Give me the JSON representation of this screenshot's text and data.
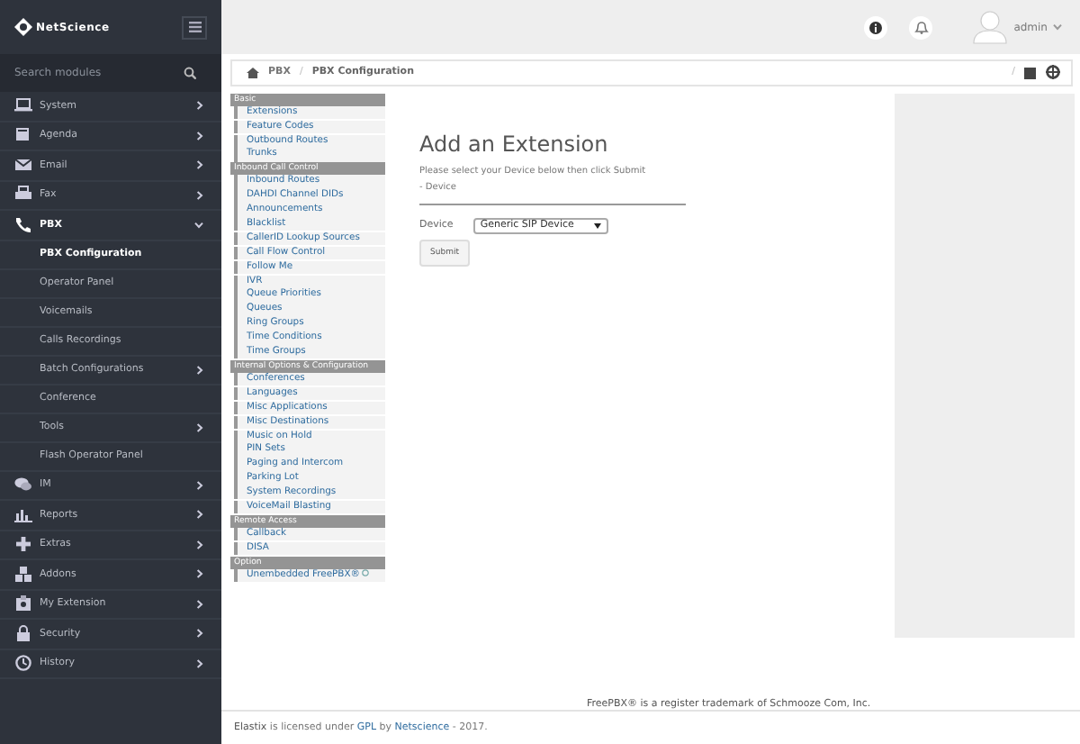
{
  "sidebar": {
    "brand": "NetScience",
    "search": {
      "placeholder": "Search modules"
    },
    "items": [
      {
        "label": "System",
        "expandable": true,
        "expanded": false
      },
      {
        "label": "Agenda",
        "expandable": true,
        "expanded": false
      },
      {
        "label": "Email",
        "expandable": true,
        "expanded": false
      },
      {
        "label": "Fax",
        "expandable": true,
        "expanded": false
      },
      {
        "label": "PBX",
        "expandable": true,
        "expanded": true,
        "children": [
          {
            "label": "PBX Configuration",
            "selected": true,
            "expandable": false
          },
          {
            "label": "Operator Panel",
            "selected": false,
            "expandable": false
          },
          {
            "label": "Voicemails",
            "selected": false,
            "expandable": false
          },
          {
            "label": "Calls Recordings",
            "selected": false,
            "expandable": false
          },
          {
            "label": "Batch Configurations",
            "selected": false,
            "expandable": true
          },
          {
            "label": "Conference",
            "selected": false,
            "expandable": false
          },
          {
            "label": "Tools",
            "selected": false,
            "expandable": true
          },
          {
            "label": "Flash Operator Panel",
            "selected": false,
            "expandable": false
          }
        ]
      },
      {
        "label": "IM",
        "expandable": true,
        "expanded": false
      },
      {
        "label": "Reports",
        "expandable": true,
        "expanded": false
      },
      {
        "label": "Extras",
        "expandable": true,
        "expanded": false
      },
      {
        "label": "Addons",
        "expandable": true,
        "expanded": false
      },
      {
        "label": "My Extension",
        "expandable": true,
        "expanded": false
      },
      {
        "label": "Security",
        "expandable": true,
        "expanded": false
      },
      {
        "label": "History",
        "expandable": true,
        "expanded": false
      }
    ]
  },
  "topbar": {
    "user": "admin"
  },
  "breadcrumb": {
    "items": [
      "PBX",
      "PBX Configuration"
    ],
    "separator": "/",
    "right_text": "/"
  },
  "pbx_nav": [
    {
      "heading": "Basic",
      "items": [
        "Extensions",
        "Feature Codes",
        "Outbound Routes",
        "Trunks"
      ]
    },
    {
      "heading": "Inbound Call Control",
      "items": [
        "Inbound Routes",
        "DAHDI Channel DIDs",
        "Announcements",
        "Blacklist",
        "CallerID Lookup Sources",
        "Call Flow Control",
        "Follow Me",
        "IVR",
        "Queue Priorities",
        "Queues",
        "Ring Groups",
        "Time Conditions",
        "Time Groups"
      ]
    },
    {
      "heading": "Internal Options & Configuration",
      "items": [
        "Conferences",
        "Languages",
        "Misc Applications",
        "Misc Destinations",
        "Music on Hold",
        "PIN Sets",
        "Paging and Intercom",
        "Parking Lot",
        "System Recordings",
        "VoiceMail Blasting"
      ]
    },
    {
      "heading": "Remote Access",
      "items": [
        "Callback",
        "DISA"
      ]
    },
    {
      "heading": "Option",
      "items": [
        "Unembedded FreePBX®"
      ]
    }
  ],
  "form": {
    "title": "Add an Extension",
    "instructions": "Please select your Device below then click Submit",
    "section": "- Device",
    "device_label": "Device",
    "device_value": "Generic SIP Device",
    "submit": "Submit"
  },
  "trademark": "FreePBX® is a register trademark of Schmooze Com, Inc.",
  "footer": {
    "product": "Elastix",
    "text1": "is licensed under",
    "license": "GPL",
    "text2": "by",
    "company": "Netscience",
    "text3": "- 2017."
  }
}
